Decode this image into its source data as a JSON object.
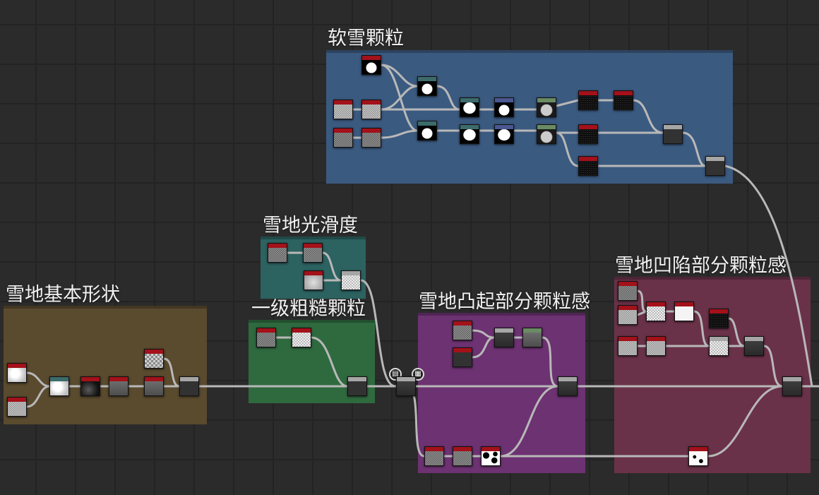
{
  "frames": [
    {
      "id": "soft-snow",
      "title": "软雪颗粒",
      "color": "#3b5a80"
    },
    {
      "id": "smoothness",
      "title": "雪地光滑度",
      "color": "#2c6260"
    },
    {
      "id": "basic-shape",
      "title": "雪地基本形状",
      "color": "#5a4a2e"
    },
    {
      "id": "coarse",
      "title": "一级粗糙颗粒",
      "color": "#2f6a3f"
    },
    {
      "id": "raised",
      "title": "雪地凸起部分颗粒感",
      "color": "#6d3272"
    },
    {
      "id": "sunken",
      "title": "雪地凹陷部分颗粒感",
      "color": "#6a3249"
    }
  ],
  "colors": {
    "hdr_red": "#a3111a",
    "hdr_teal": "#3d6b6b",
    "hdr_blue": "#4b5790",
    "hdr_green": "#6a8b63",
    "hdr_gray": "#a6a6a6",
    "wire": "#b8b8b8"
  }
}
